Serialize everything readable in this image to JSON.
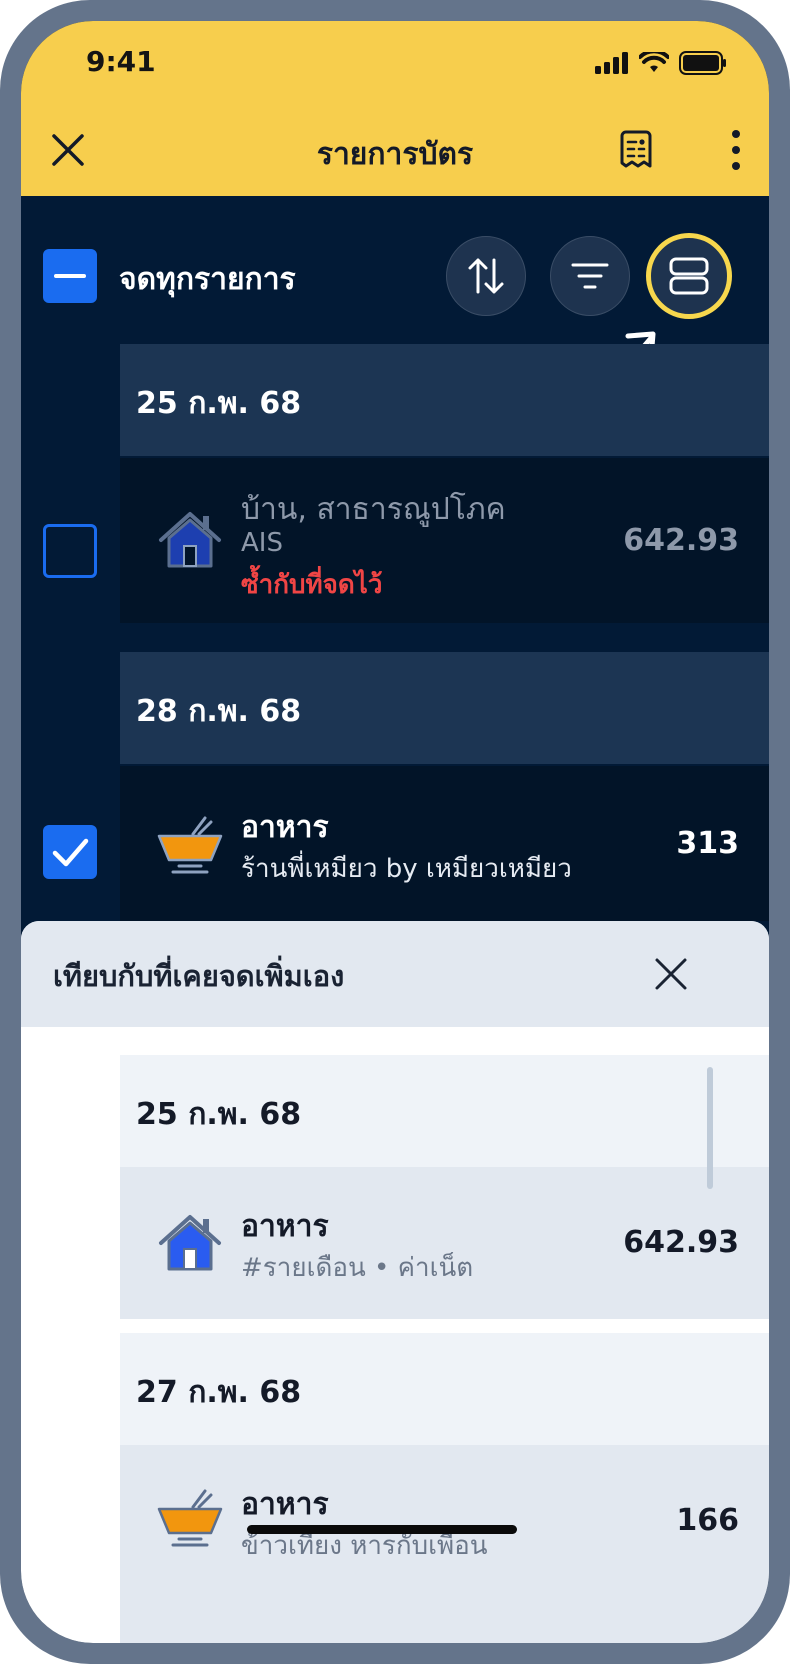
{
  "status": {
    "time": "9:41"
  },
  "header": {
    "title": "รายการบัตร"
  },
  "toolbar": {
    "select_all_label": "จดทุกรายการ"
  },
  "list": [
    {
      "date": "25 ก.พ. 68",
      "category": "บ้าน, สาธารณูปโภค",
      "subtitle": "AIS",
      "warning": "ซ้ำกับที่จดไว้",
      "amount": "642.93",
      "checked": false,
      "icon": "house-icon"
    },
    {
      "date": "28 ก.พ. 68",
      "category": "อาหาร",
      "subtitle": "ร้านพี่เหมียว by เหมียวเหมียว",
      "amount": "313",
      "checked": true,
      "icon": "food-bowl-icon"
    }
  ],
  "sheet": {
    "title": "เทียบกับที่เคยจดเพิ่มเอง",
    "items": [
      {
        "date": "25 ก.พ. 68",
        "category": "อาหาร",
        "subtitle": "#รายเดือน • ค่าเน็ต",
        "amount": "642.93",
        "icon": "house-icon"
      },
      {
        "date": "27 ก.พ. 68",
        "category": "อาหาร",
        "subtitle": "ข้าวเที่ยง หารกับเพื่อน",
        "amount": "166",
        "icon": "food-bowl-icon"
      }
    ]
  },
  "colors": {
    "accent_yellow": "#f7ce4d",
    "dark_bg": "#021a36",
    "checkbox_blue": "#1a6cf0",
    "warning_red": "#f04545"
  }
}
